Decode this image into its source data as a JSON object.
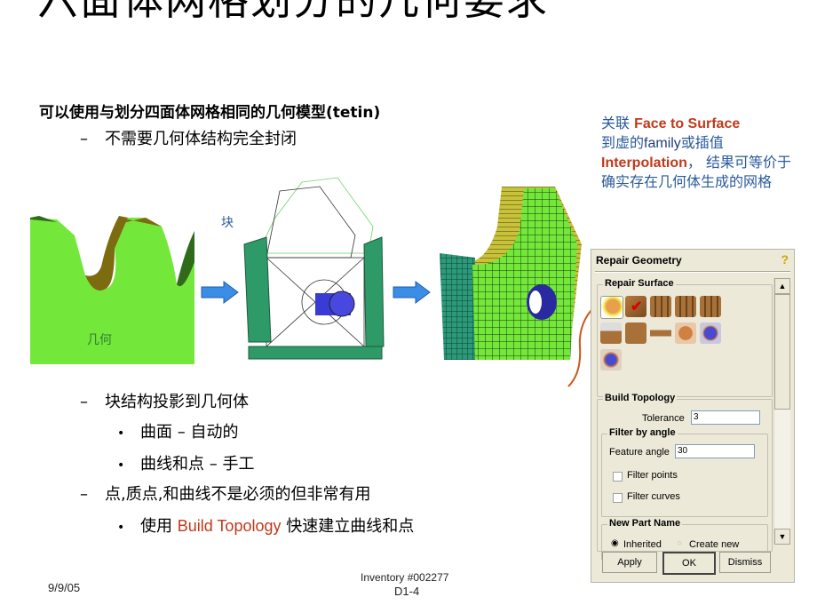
{
  "slide": {
    "title": "六面体网格划分的几何要求",
    "bullets": {
      "level1": "可以使用与划分四面体网格相同的几何模型(tetin)",
      "level2a": "不需要几何体结构完全封闭",
      "level2b": "块结构投影到几何体",
      "level3a": "曲面 – 自动的",
      "level3b": "曲线和点 – 手工",
      "level2c": "点,质点,和曲线不是必须的但非常有用",
      "level3c_pre": "使用 ",
      "level3c_accent": "Build Topology",
      "level3c_post": " 快速建立曲线和点"
    },
    "dash": "–",
    "bullet": "•",
    "figure_labels": {
      "geometry": "几何",
      "block": "块"
    },
    "callout": {
      "p1": "关联 ",
      "b1": "Face to Surface",
      "p2": "到虚的",
      "en": "family",
      "p3": "或插值",
      "b2": "Interpolation",
      "p4": "， 结果可等价于确实存在几何体生成的网格"
    },
    "footer": {
      "date": "9/9/05",
      "inventory": "Inventory #002277",
      "page": "D1-4"
    },
    "colors": {
      "accent": "#c0391b",
      "callout_text": "#2a5b9a",
      "geometry_green": "#74e83a",
      "arrow_blue": "#3a8ee6"
    }
  },
  "dialog": {
    "title": "Repair Geometry",
    "help_icon": "?",
    "repair_surface": {
      "label": "Repair Surface",
      "tools": [
        "check-geometry-icon",
        "close-holes-icon",
        "stitch-match-edges-icon",
        "split-surface-icon",
        "merge-edges-icon",
        "segment-curve-icon",
        "adjust-varying-thickness-icon",
        "modify-surface-normals-icon",
        "find-holes-icon",
        "remove-holes-icon",
        "build-topology-probe-icon"
      ]
    },
    "build_topology": {
      "label": "Build Topology",
      "tolerance_label": "Tolerance",
      "tolerance_value": "3",
      "filter_by_angle": {
        "label": "Filter by angle",
        "feature_angle_label": "Feature angle",
        "feature_angle_value": "30",
        "filter_points": "Filter points",
        "filter_curves": "Filter curves"
      },
      "new_part_name": {
        "label": "New Part Name",
        "inherited": "Inherited",
        "create_new": "Create new"
      }
    },
    "buttons": {
      "apply": "Apply",
      "ok": "OK",
      "dismiss": "Dismiss"
    }
  }
}
